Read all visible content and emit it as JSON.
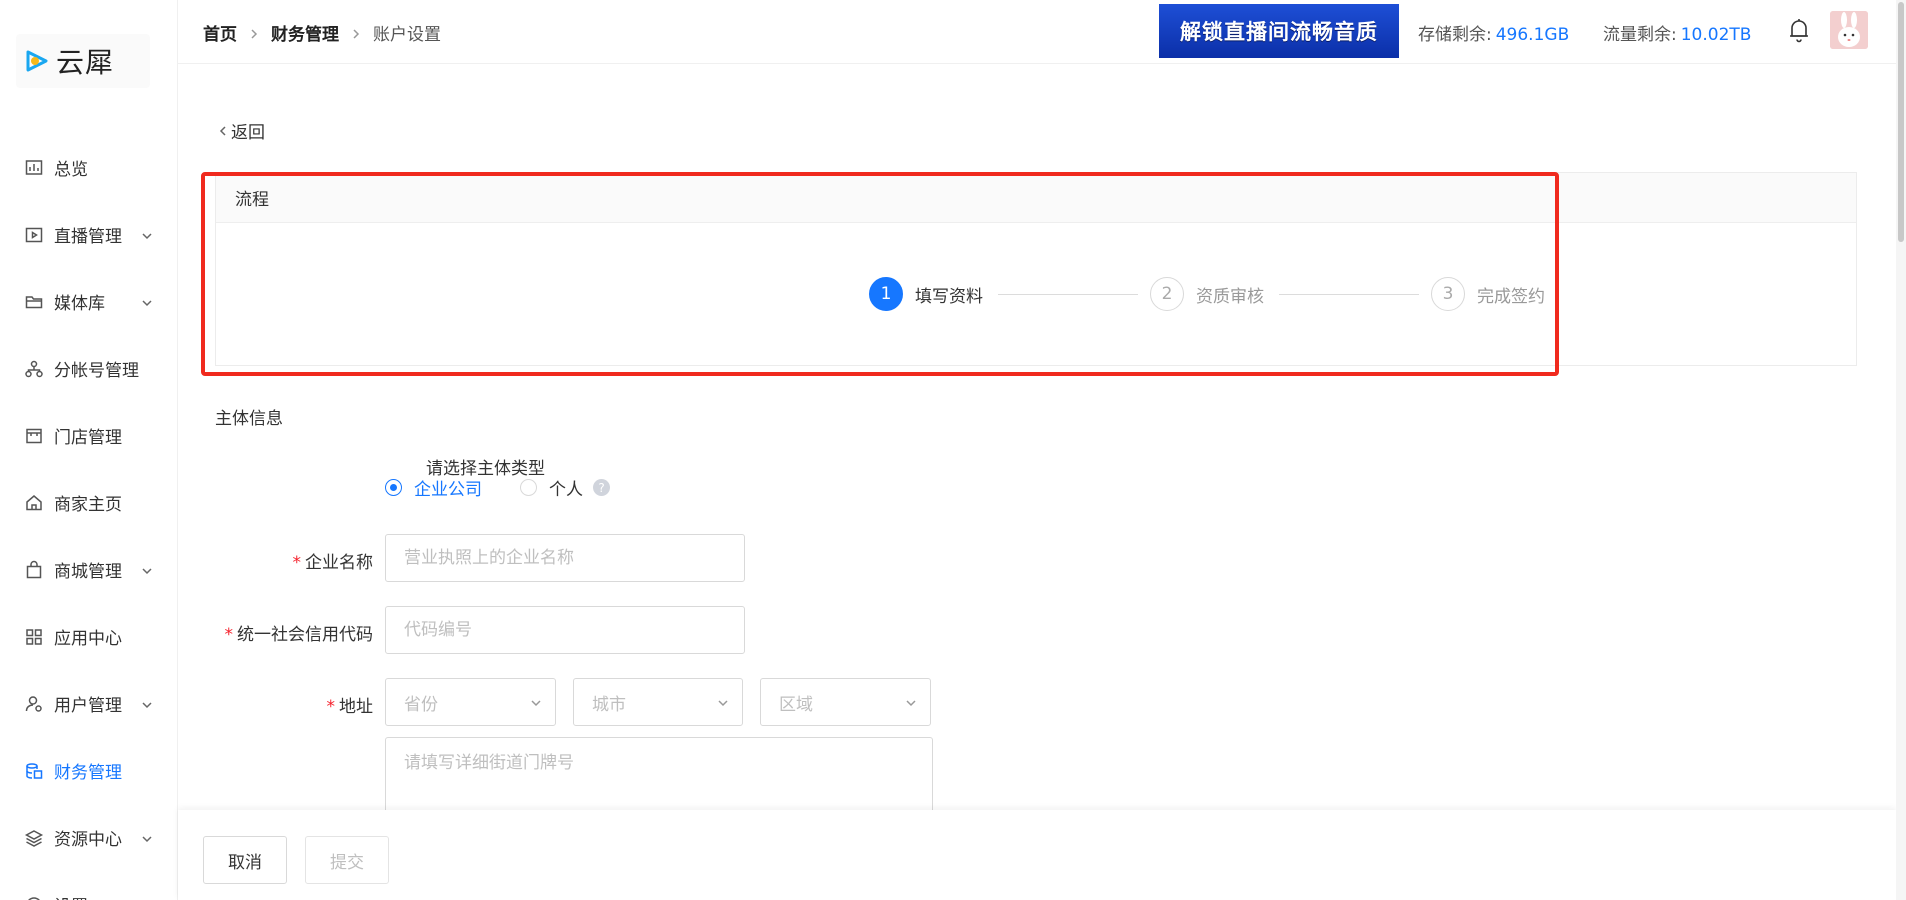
{
  "brand": {
    "name": "云犀"
  },
  "sidebar": {
    "items": [
      {
        "label": "总览",
        "icon": "chart-icon",
        "expandable": false
      },
      {
        "label": "直播管理",
        "icon": "play-icon",
        "expandable": true
      },
      {
        "label": "媒体库",
        "icon": "folder-icon",
        "expandable": true
      },
      {
        "label": "分帐号管理",
        "icon": "org-icon",
        "expandable": false
      },
      {
        "label": "门店管理",
        "icon": "store-icon",
        "expandable": false
      },
      {
        "label": "商家主页",
        "icon": "home-icon",
        "expandable": false
      },
      {
        "label": "商城管理",
        "icon": "bag-icon",
        "expandable": true
      },
      {
        "label": "应用中心",
        "icon": "grid-icon",
        "expandable": false
      },
      {
        "label": "用户管理",
        "icon": "user-icon",
        "expandable": true
      },
      {
        "label": "财务管理",
        "icon": "coins-icon",
        "expandable": false,
        "active": true
      },
      {
        "label": "资源中心",
        "icon": "layers-icon",
        "expandable": true
      },
      {
        "label": "设置",
        "icon": "gear-icon",
        "expandable": true
      }
    ]
  },
  "header": {
    "breadcrumb": [
      "首页",
      "财务管理",
      "账户设置"
    ],
    "banner_text": "解锁直播间流畅音质",
    "storage_label": "存储剩余:",
    "storage_value": "496.1GB",
    "traffic_label": "流量剩余:",
    "traffic_value": "10.02TB"
  },
  "content": {
    "back_label": "返回",
    "process": {
      "title": "流程",
      "steps": [
        {
          "num": "1",
          "label": "填写资料",
          "active": true
        },
        {
          "num": "2",
          "label": "资质审核",
          "active": false
        },
        {
          "num": "3",
          "label": "完成签约",
          "active": false
        }
      ]
    },
    "section_title": "主体信息",
    "form": {
      "entity_type_label": "请选择主体类型",
      "entity_options": [
        "企业公司",
        "个人"
      ],
      "entity_selected": "企业公司",
      "company_name_label": "企业名称",
      "company_name_placeholder": "营业执照上的企业名称",
      "credit_code_label": "统一社会信用代码",
      "credit_code_placeholder": "代码编号",
      "address_label": "地址",
      "province_placeholder": "省份",
      "city_placeholder": "城市",
      "district_placeholder": "区域",
      "street_placeholder": "请填写详细街道门牌号"
    }
  },
  "footer": {
    "cancel_label": "取消",
    "submit_label": "提交"
  },
  "colors": {
    "accent": "#1677ff",
    "required": "#f5222d",
    "highlight_border": "#f02a1e"
  }
}
